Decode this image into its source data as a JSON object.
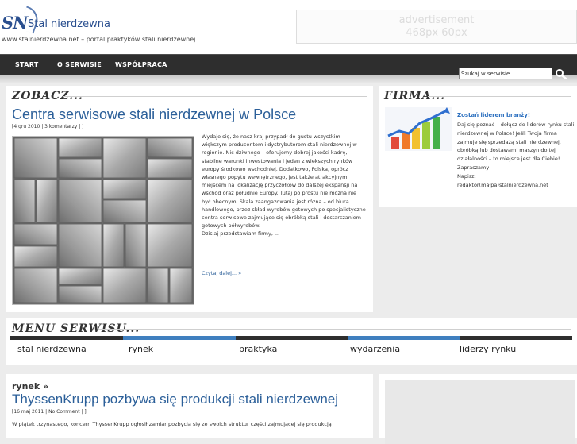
{
  "header": {
    "logo_mark": "SN",
    "logo_text": "Stal nierdzewna",
    "tagline": "www.stalnierdzewna.net – portal praktyków stali nierdzewnej",
    "ad_line1": "advertisement",
    "ad_line2": "468px 60px"
  },
  "nav": {
    "items": [
      "START",
      "O SERWISIE",
      "WSPÓŁPRACA"
    ],
    "search_value": "Szukaj w serwisie...",
    "search_icon": "magnifier-icon"
  },
  "main": {
    "section_title": "ZOBACZ...",
    "post": {
      "title": "Centra serwisowe stali nierdzewnej w Polsce",
      "meta": "[4 gru 2010 | 3 komentarzy | ]",
      "excerpt": "Wydaje się, że nasz kraj przypadł do gustu wszystkim większym producentom i dystrybutorom stali nierdzewnej w regionie. Nic dziwnego – oferujemy dobrej jakości kadrę, stabilne warunki inwestowania i jeden z większych rynków europy środkowo wschodniej. Dodatkowo, Polska, oprócz własnego popytu wewnętrznego, jest także atrakcyjnym miejscem na lokalizację przyczółków do dalszej ekspansji na wschód oraz południe Europy. Tutaj po prostu nie można nie być obecnym. Skala zaangażowania jest różna – od biura handlowego, przez skład wyrobów gotowych po specjalistyczne centra serwisowe zajmujące się obróbką stali i dostarczaniem gotowych półwyrobów.",
      "excerpt_tail": "Dzisiaj przedstawiam firmy, ...",
      "read_more": "Czytaj dalej... »"
    }
  },
  "sidebar": {
    "section_title": "FIRMA...",
    "promo_title": "Zostań liderem branży!",
    "promo_text": "Daj się poznać – dołącz do liderów rynku stali nierdzewnej w Polsce! Jeśli Twoja firma zajmuje się sprzedażą stali nierdzewnej, obróbką lub dostawami maszyn do tej działalności – to miejsce jest dla Ciebie! Zapraszamy!",
    "contact_label": "Napisz:",
    "contact_email": "redaktor(małpa)stalnierdzewna.net"
  },
  "menu": {
    "section_title": "MENU SERWISU...",
    "items": [
      "stal nierdzewna",
      "rynek",
      "praktyka",
      "wydarzenia",
      "liderzy rynku"
    ],
    "colors": [
      "#2e2e2e",
      "#3f7fbf",
      "#2e2e2e",
      "#3f7fbf",
      "#2e2e2e"
    ]
  },
  "post2": {
    "category": "rynek »",
    "title": "ThyssenKrupp pozbywa się produkcji stali nierdzewnej",
    "meta": "[16 maj 2011 | No Comment | ]",
    "excerpt": "W piątek trzynastego, koncern ThyssenKrupp ogłosił zamiar pozbycia się ze swoich struktur części zajmującej się produkcją"
  },
  "colors": {
    "accent_blue": "#2b5f99",
    "nav_bg": "#2e2e2e",
    "menu_blue": "#3f7fbf"
  }
}
